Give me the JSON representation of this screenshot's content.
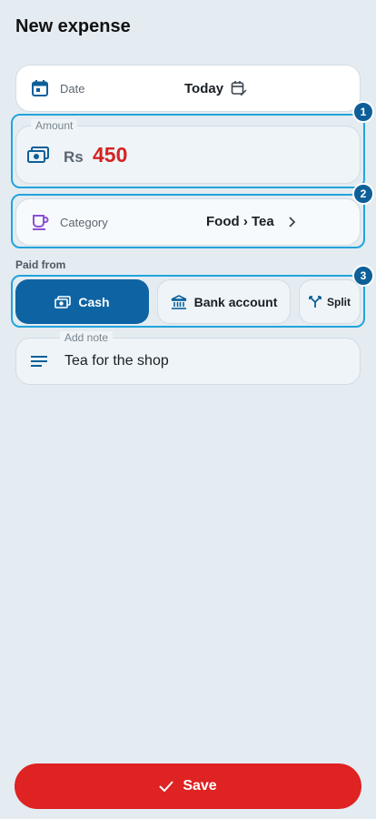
{
  "header": {
    "title": "New expense"
  },
  "date": {
    "label": "Date",
    "value": "Today",
    "icon": "calendar-icon",
    "edit_icon": "calendar-edit-icon"
  },
  "amount": {
    "legend": "Amount",
    "currency": "Rs",
    "value": "450",
    "icon": "cash-icon",
    "value_color": "#d42323"
  },
  "category": {
    "label": "Category",
    "value": "Food › Tea",
    "icon": "cup-icon"
  },
  "paid_from": {
    "label": "Paid from",
    "options": [
      {
        "label": "Cash",
        "icon": "cash-icon",
        "selected": true
      },
      {
        "label": "Bank account",
        "icon": "bank-icon",
        "selected": false
      },
      {
        "label": "Split",
        "icon": "split-icon",
        "selected": false
      }
    ]
  },
  "note": {
    "legend": "Add note",
    "value": "Tea for the shop",
    "icon": "notes-icon"
  },
  "steps": [
    "1",
    "2",
    "3"
  ],
  "actions": {
    "save_label": "Save"
  },
  "colors": {
    "accent": "#0e64a3",
    "highlight": "#22a4da",
    "danger": "#df2222"
  }
}
